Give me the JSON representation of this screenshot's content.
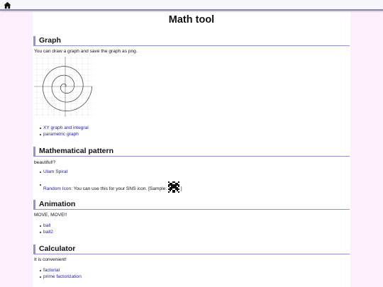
{
  "topbar": {
    "home_icon": "home-icon"
  },
  "page": {
    "title": "Math tool"
  },
  "sections": {
    "graph": {
      "heading": "Graph",
      "desc": "You can draw a graph and save the graph as png.",
      "image": "spiral-graph-thumbnail",
      "links": [
        "XY graph and integral",
        "parametric graph"
      ]
    },
    "pattern": {
      "heading": "Mathematical pattern",
      "desc": "beautiful!?",
      "links": [
        "Ulam Spiral",
        "Random Icon"
      ],
      "random_icon_note": ": You can use this for your SNS icon. [Sample:",
      "random_icon_close": "]",
      "sample_icon": "random-pattern-icon"
    },
    "animation": {
      "heading": "Animation",
      "desc": "MOVE, MOVE!!",
      "links": [
        "ball",
        "ball2"
      ]
    },
    "calculator": {
      "heading": "Calculator",
      "desc": "It is convenient!",
      "links": [
        "factorial",
        "prime factorization"
      ]
    }
  },
  "colors": {
    "accent": "#8f8fdc",
    "link": "#1a1aa8",
    "page_bg": "#fcf0fc"
  }
}
